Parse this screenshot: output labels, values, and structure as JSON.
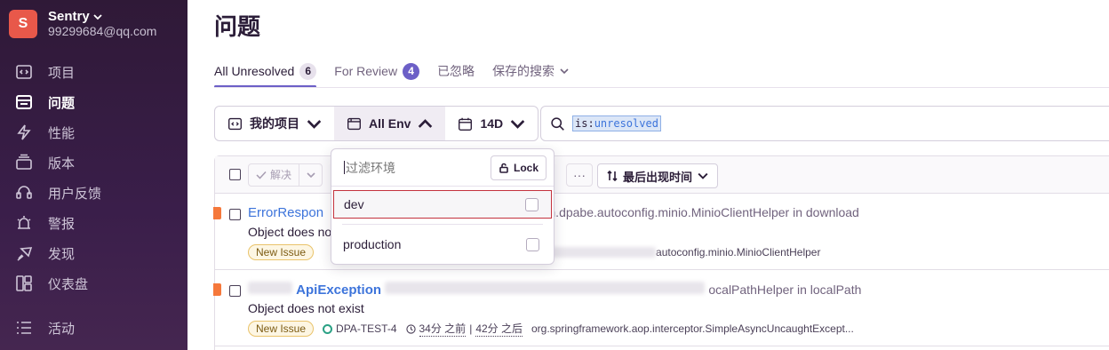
{
  "org": {
    "initial": "S",
    "name": "Sentry",
    "email": "99299684@qq.com"
  },
  "nav": [
    {
      "label": "项目",
      "icon": "project-icon",
      "active": false
    },
    {
      "label": "问题",
      "icon": "issues-icon",
      "active": true
    },
    {
      "label": "性能",
      "icon": "performance-icon",
      "active": false
    },
    {
      "label": "版本",
      "icon": "releases-icon",
      "active": false
    },
    {
      "label": "用户反馈",
      "icon": "feedback-icon",
      "active": false
    },
    {
      "label": "警报",
      "icon": "alerts-icon",
      "active": false
    },
    {
      "label": "发现",
      "icon": "discover-icon",
      "active": false
    },
    {
      "label": "仪表盘",
      "icon": "dashboard-icon",
      "active": false
    },
    {
      "label": "活动",
      "icon": "activity-icon",
      "active": false
    }
  ],
  "page": {
    "title": "问题"
  },
  "tabs": [
    {
      "label": "All Unresolved",
      "count": "6"
    },
    {
      "label": "For Review",
      "count": "4"
    },
    {
      "label": "已忽略"
    },
    {
      "label": "保存的搜索"
    }
  ],
  "filters": {
    "project": "我的项目",
    "env": "All Env",
    "date": "14D"
  },
  "search": {
    "key": "is:",
    "value": "unresolved"
  },
  "toolbar": {
    "resolve": "解决",
    "more": "···",
    "sort": "最后出现时间"
  },
  "issues": [
    {
      "title": "ErrorRespon",
      "culprit": "n.dpabe.autoconfig.minio.MinioClientHelper in download",
      "message": "Object does no",
      "badge": "New Issue",
      "extra": "autoconfig.minio.MinioClientHelper"
    },
    {
      "title": "ApiException",
      "culprit": "ocalPathHelper in localPath",
      "message": "Object does not exist",
      "badge": "New Issue",
      "project": "DPA-TEST-4",
      "first_seen": "34分 之前",
      "last_seen": "42分 之后",
      "extra": "org.springframework.aop.interceptor.SimpleAsyncUncaughtExcept..."
    }
  ],
  "env_dropdown": {
    "placeholder": "过滤环境",
    "lock_label": "Lock",
    "options": [
      "dev",
      "production"
    ]
  },
  "colors": {
    "sidebar": "#2f1937",
    "accent": "#6c5fc7",
    "link": "#3d74db",
    "error": "#f5783b"
  }
}
